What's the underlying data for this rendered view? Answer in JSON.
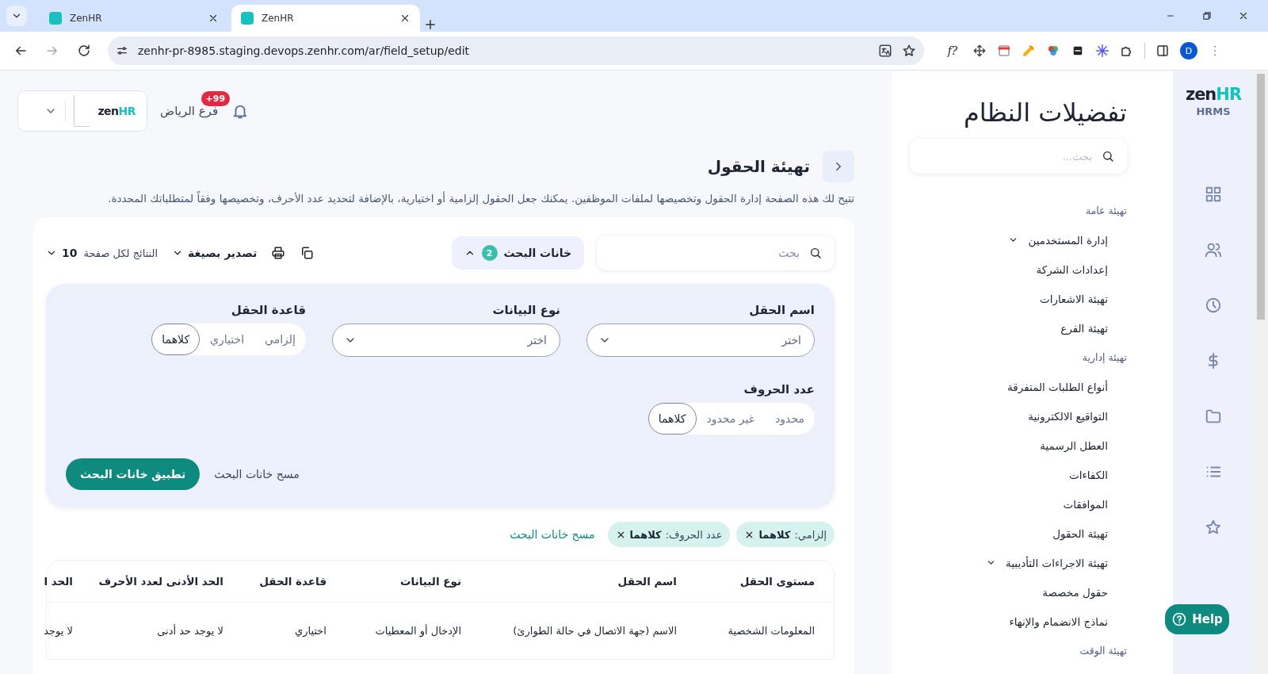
{
  "browser": {
    "tabs": {
      "first": {
        "title": "ZenHR",
        "selected": false
      },
      "second": {
        "title": "ZenHR",
        "selected": true
      }
    },
    "url": "zenhr-pr-8985.staging.devops.zenhr.com/ar/field_setup/edit",
    "extension_label": "f?",
    "profile_initial": "D"
  },
  "header": {
    "logo": {
      "prefix": "zen",
      "suffix": "HR"
    },
    "branch": "فرع الرياض",
    "notifications": "+99"
  },
  "page": {
    "title": "تهيئة الحقول",
    "description": "تتيح لك هذه الصفحة إدارة الحقول وتخصيصها لملفات الموظفين. يمكنك جعل الحقول إلزامية أو اختيارية، بالإضافة لتحديد عدد الأحرف، وتخصيصها وفقاً لمتطلباتك المحددة."
  },
  "toolbar": {
    "search_placeholder": "بحث",
    "filters_label": "خانات البحث",
    "filters_count": "2",
    "filters_expanded": true,
    "export_label": "تصدير بصيغة",
    "per_page_label": "النتائج لكل صفحة",
    "per_page_value": "10"
  },
  "filters": {
    "fields": [
      {
        "kind": "select",
        "label": "اسم الحقل",
        "placeholder": "اختر"
      },
      {
        "kind": "select",
        "label": "نوع البيانات",
        "placeholder": "اختر"
      },
      {
        "kind": "segmented",
        "label": "قاعدة الحقل",
        "options": [
          {
            "label": "إلزامي",
            "selected": false
          },
          {
            "label": "اختياري",
            "selected": false
          },
          {
            "label": "كلاهما",
            "selected": true
          }
        ]
      },
      {
        "kind": "segmented",
        "label": "عدد الحروف",
        "options": [
          {
            "label": "محدود",
            "selected": false
          },
          {
            "label": "غير محدود",
            "selected": false
          },
          {
            "label": "كلاهما",
            "selected": true
          }
        ]
      }
    ],
    "clear": "مسح خانات البحث",
    "apply": "تطبيق خانات البحث"
  },
  "active_filters": {
    "chips": [
      {
        "label": "إلزامي:",
        "value": "كلاهما"
      },
      {
        "label": "عدد الحروف:",
        "value": "كلاهما"
      }
    ],
    "clear": "مسح خانات البحث"
  },
  "table": {
    "columns": [
      "مستوى الحقل",
      "اسم الحقل",
      "نوع البيانات",
      "قاعدة الحقل",
      "الحد الأدنى لعدد الأحرف",
      "الحد ا"
    ],
    "rows": [
      [
        "المعلومات الشخصية",
        "الاسم (جهة الاتصال في حالة الطوارئ)",
        "الإدخال أو المعطيات",
        "اختياري",
        "لا يوجد حد أدنى",
        "لا يوجد"
      ]
    ]
  },
  "settings_nav": {
    "title": "تفضيلات النظام",
    "search_placeholder": "بحث...",
    "sections": [
      {
        "title": "تهيئة عامة",
        "items": [
          {
            "label": "إدارة المستخدمين",
            "has_submenu": true
          },
          {
            "label": "إعدادات الشركة",
            "has_submenu": false
          },
          {
            "label": "تهيئة الاشعارات",
            "has_submenu": false
          },
          {
            "label": "تهيئة الفرع",
            "has_submenu": false
          }
        ]
      },
      {
        "title": "تهيئة إدارية",
        "items": [
          {
            "label": "أنواع الطلبات المتفرقة",
            "has_submenu": false
          },
          {
            "label": "التواقيع الالكترونية",
            "has_submenu": false
          },
          {
            "label": "العطل الرسمية",
            "has_submenu": false
          },
          {
            "label": "الكفاءات",
            "has_submenu": false
          },
          {
            "label": "الموافقات",
            "has_submenu": false
          },
          {
            "label": "تهيئة الحقول",
            "has_submenu": false
          },
          {
            "label": "تهيئة الاجراءات التأديبية",
            "has_submenu": true
          },
          {
            "label": "حقول مخصصة",
            "has_submenu": false
          },
          {
            "label": "نماذج الانضمام والإنهاء",
            "has_submenu": false
          }
        ]
      },
      {
        "title": "تهيئة الوقت"
      }
    ]
  },
  "rail": {
    "logo": {
      "prefix": "zen",
      "suffix": "HR"
    },
    "product": "HRMS"
  },
  "help_button": "Help"
}
